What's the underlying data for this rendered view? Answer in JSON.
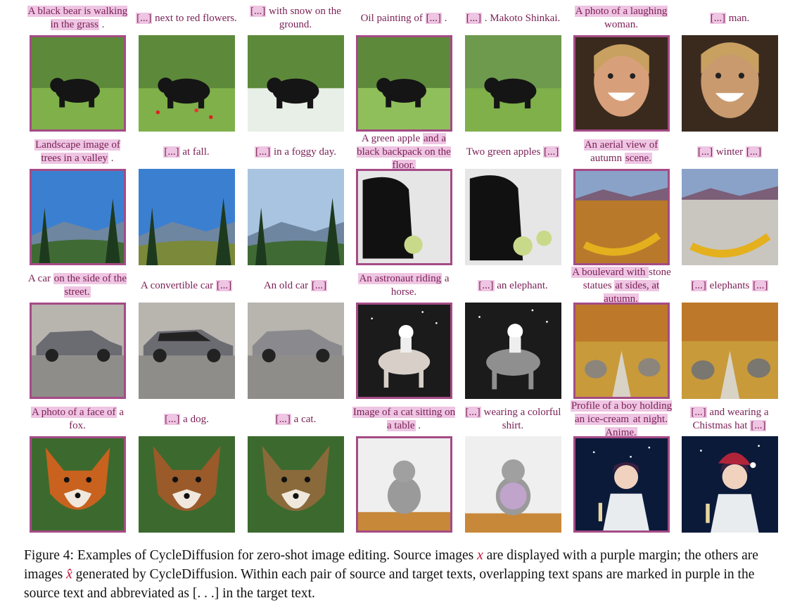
{
  "rows": [
    {
      "captions": [
        [
          {
            "t": "A black bear is walking in the grass",
            "hl": true
          },
          {
            "t": " .",
            "hl": false
          }
        ],
        [
          {
            "t": "[...]",
            "hl": true
          },
          {
            "t": " next to red flowers.",
            "hl": false
          }
        ],
        [
          {
            "t": "[...]",
            "hl": true
          },
          {
            "t": " with snow on the ground.",
            "hl": false
          }
        ],
        [
          {
            "t": "Oil painting of ",
            "hl": false
          },
          {
            "t": "[...]",
            "hl": true
          },
          {
            "t": " .",
            "hl": false
          }
        ],
        [
          {
            "t": "[...]",
            "hl": true
          },
          {
            "t": " . Makoto Shinkai.",
            "hl": false
          }
        ],
        [
          {
            "t": "A photo of a laughing",
            "hl": true
          },
          {
            "t": " woman.",
            "hl": false
          }
        ],
        [
          {
            "t": "[...]",
            "hl": true
          },
          {
            "t": " man.",
            "hl": false
          }
        ]
      ],
      "images": [
        "bear-source",
        "bear-red-flowers",
        "bear-snow",
        "bear-oil-painting",
        "bear-shinkai",
        "woman-source",
        "man"
      ]
    },
    {
      "captions": [
        [
          {
            "t": "Landscape image of trees in a valley",
            "hl": true
          },
          {
            "t": " .",
            "hl": false
          }
        ],
        [
          {
            "t": "[...]",
            "hl": true
          },
          {
            "t": " at fall.",
            "hl": false
          }
        ],
        [
          {
            "t": "[...]",
            "hl": true
          },
          {
            "t": " in a foggy day.",
            "hl": false
          }
        ],
        [
          {
            "t": "A green apple ",
            "hl": false
          },
          {
            "t": "and a black backpack on the floor.",
            "hl": true
          }
        ],
        [
          {
            "t": "Two green apples ",
            "hl": false
          },
          {
            "t": "[...]",
            "hl": true
          }
        ],
        [
          {
            "t": "An aerial view of",
            "hl": true
          },
          {
            "t": " autumn ",
            "hl": false
          },
          {
            "t": "scene.",
            "hl": true
          }
        ],
        [
          {
            "t": "[...]",
            "hl": true
          },
          {
            "t": " winter ",
            "hl": false
          },
          {
            "t": "[...]",
            "hl": true
          }
        ]
      ],
      "images": [
        "valley-source",
        "valley-fall",
        "valley-fog",
        "apple-source",
        "two-apples",
        "aerial-autumn-source",
        "aerial-winter"
      ]
    },
    {
      "captions": [
        [
          {
            "t": "A car ",
            "hl": false
          },
          {
            "t": "on the side of the street.",
            "hl": true
          }
        ],
        [
          {
            "t": "A convertible car ",
            "hl": false
          },
          {
            "t": "[...]",
            "hl": true
          }
        ],
        [
          {
            "t": "An old car ",
            "hl": false
          },
          {
            "t": "[...]",
            "hl": true
          }
        ],
        [
          {
            "t": "An astronaut riding",
            "hl": true
          },
          {
            "t": " a horse.",
            "hl": false
          }
        ],
        [
          {
            "t": "[...]",
            "hl": true
          },
          {
            "t": " an elephant.",
            "hl": false
          }
        ],
        [
          {
            "t": "A boulevard with ",
            "hl": true
          },
          {
            "t": "stone statues ",
            "hl": false
          },
          {
            "t": "at sides, at autumn.",
            "hl": true
          }
        ],
        [
          {
            "t": "[...]",
            "hl": true
          },
          {
            "t": " elephants ",
            "hl": false
          },
          {
            "t": "[...]",
            "hl": true
          }
        ]
      ],
      "images": [
        "car-source",
        "car-convertible",
        "car-old",
        "astronaut-horse-source",
        "astronaut-elephant",
        "boulevard-statues-source",
        "boulevard-elephants"
      ]
    },
    {
      "captions": [
        [
          {
            "t": "A photo of a face of",
            "hl": true
          },
          {
            "t": " a fox.",
            "hl": false
          }
        ],
        [
          {
            "t": "[...]",
            "hl": true
          },
          {
            "t": " a dog.",
            "hl": false
          }
        ],
        [
          {
            "t": "[...]",
            "hl": true
          },
          {
            "t": " a cat.",
            "hl": false
          }
        ],
        [
          {
            "t": "Image of a cat sitting on a table",
            "hl": true
          },
          {
            "t": " .",
            "hl": false
          }
        ],
        [
          {
            "t": "[...]",
            "hl": true
          },
          {
            "t": " wearing a colorful shirt.",
            "hl": false
          }
        ],
        [
          {
            "t": "Profile of a boy holding an ice-cream",
            "hl": true
          },
          {
            "t": " at night. Anime.",
            "hl": true
          }
        ],
        [
          {
            "t": "[...]",
            "hl": true
          },
          {
            "t": " and wearing a Chistmas hat ",
            "hl": false
          },
          {
            "t": "[...]",
            "hl": true
          }
        ]
      ],
      "images": [
        "fox-source",
        "dog",
        "cat-face",
        "cat-table-source",
        "cat-shirt",
        "boy-icecream-source",
        "boy-christmas-hat"
      ]
    }
  ],
  "sourceColumns": [
    0,
    3,
    5
  ],
  "caption": {
    "p1": "Figure 4:  Examples of CycleDiffusion for zero-shot image editing. Source images ",
    "x": "x",
    "p2": " are displayed with a purple margin; the others are images ",
    "xhat": "x̂",
    "p3": " generated by CycleDiffusion. Within each pair of source and target texts, overlapping text spans are marked in purple in the source text and abbreviated as [. . .] in the target text."
  },
  "colors": {
    "accent": "#a54b86",
    "highlight": "#eec5e2",
    "text": "#7a1f55"
  }
}
